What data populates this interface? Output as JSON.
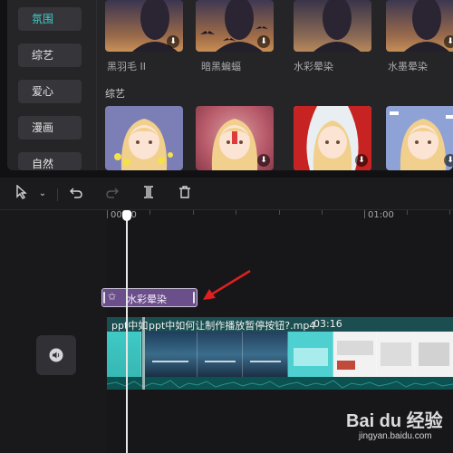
{
  "categories": [
    {
      "label": "氛围",
      "active": true
    },
    {
      "label": "综艺",
      "active": false
    },
    {
      "label": "爱心",
      "active": false
    },
    {
      "label": "漫画",
      "active": false
    },
    {
      "label": "自然",
      "active": false
    }
  ],
  "effects_row1": [
    {
      "label": "黑羽毛 II"
    },
    {
      "label": "暗黑蝙蝠"
    },
    {
      "label": "水彩晕染"
    },
    {
      "label": "水墨晕染"
    }
  ],
  "section_title": "综艺",
  "toolbar": {
    "select_icon": "cursor-icon",
    "undo_icon": "undo-icon",
    "redo_icon": "redo-icon",
    "split_icon": "split-icon",
    "delete_icon": "trash-icon"
  },
  "timeline": {
    "time_start": "00:00",
    "time_mark": "01:00",
    "effect_clip_label": "水彩晕染",
    "clip1_title": "ppt中如",
    "clip2_title": "ppt中如何让制作播放暂停按钮?.mp4",
    "clip2_duration": "03:16"
  },
  "watermark": {
    "brand": "Bai du 经验",
    "url": "jingyan.baidu.com"
  },
  "colors": {
    "accent": "#3fd0c9",
    "effect_clip": "#6b4f8a",
    "video_track": "#0f6a68",
    "annotation_arrow": "#e02020"
  }
}
